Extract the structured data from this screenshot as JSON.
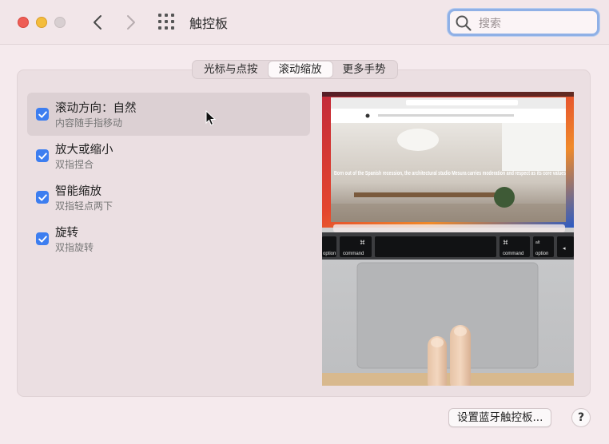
{
  "window": {
    "title": "触控板",
    "search_placeholder": "搜索"
  },
  "tabs": [
    {
      "label": "光标与点按",
      "active": false
    },
    {
      "label": "滚动缩放",
      "active": true
    },
    {
      "label": "更多手势",
      "active": false
    }
  ],
  "options": [
    {
      "title": "滚动方向：自然",
      "subtitle": "内容随手指移动",
      "checked": true,
      "selected": true
    },
    {
      "title": "放大或缩小",
      "subtitle": "双指捏合",
      "checked": true,
      "selected": false
    },
    {
      "title": "智能缩放",
      "subtitle": "双指轻点两下",
      "checked": true,
      "selected": false
    },
    {
      "title": "旋转",
      "subtitle": "双指旋转",
      "checked": true,
      "selected": false
    }
  ],
  "preview": {
    "headline": "Born out of the Spanish recession, the architectural studio Mesura carries moderation and respect as its core values",
    "keys": {
      "left_symbol": "⌘",
      "left_label": "command",
      "left_alt": "alt",
      "left_alt_label": "option",
      "right_symbol": "⌘",
      "right_label": "command",
      "right_alt": "alt",
      "right_alt_label": "option",
      "far_left_label": "option",
      "far_right": "◂"
    }
  },
  "footer": {
    "bluetooth_button": "设置蓝牙触控板...",
    "help_button": "?"
  },
  "colors": {
    "accent": "#3d7ef0",
    "window_bg": "#f5eaed",
    "panel_bg": "#ebdfe2"
  }
}
